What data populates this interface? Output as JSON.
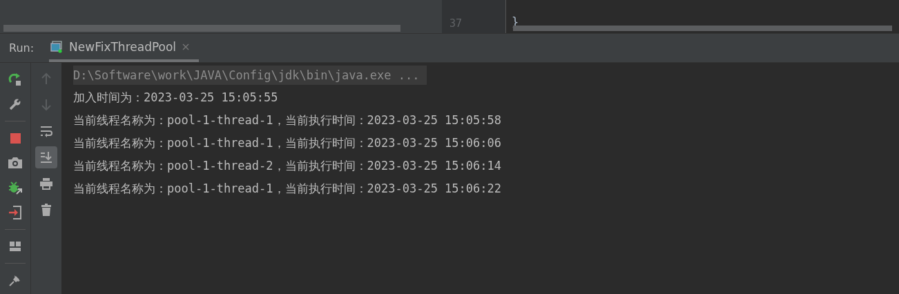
{
  "editor": {
    "line_number": "37",
    "code": "}"
  },
  "run_panel": {
    "label": "Run:",
    "tabs": [
      {
        "label": "NewFixThreadPool",
        "selected": true
      }
    ]
  },
  "left_toolbar": [
    {
      "kind": "rerun"
    },
    {
      "kind": "settings"
    },
    {
      "kind": "separator"
    },
    {
      "kind": "stop"
    },
    {
      "kind": "camera"
    },
    {
      "kind": "debug"
    },
    {
      "kind": "exit"
    },
    {
      "kind": "separator"
    },
    {
      "kind": "layout"
    },
    {
      "kind": "separator"
    },
    {
      "kind": "pin"
    }
  ],
  "right_toolbar": [
    {
      "kind": "up",
      "disabled": true,
      "selected": false
    },
    {
      "kind": "down",
      "disabled": true,
      "selected": false
    },
    {
      "kind": "wrap",
      "disabled": false,
      "selected": false
    },
    {
      "kind": "scroll-end",
      "disabled": false,
      "selected": true
    },
    {
      "kind": "print",
      "disabled": false,
      "selected": false
    },
    {
      "kind": "trash",
      "disabled": false,
      "selected": false
    }
  ],
  "console": [
    {
      "kind": "command",
      "text": "D:\\Software\\work\\JAVA\\Config\\jdk\\bin\\java.exe ..."
    },
    {
      "kind": "output",
      "text": "加入时间为：2023-03-25 15:05:55"
    },
    {
      "kind": "output",
      "text": "当前线程名称为：pool-1-thread-1，当前执行时间：2023-03-25 15:05:58"
    },
    {
      "kind": "output",
      "text": "当前线程名称为：pool-1-thread-1，当前执行时间：2023-03-25 15:06:06"
    },
    {
      "kind": "output",
      "text": "当前线程名称为：pool-1-thread-2，当前执行时间：2023-03-25 15:06:14"
    },
    {
      "kind": "output",
      "text": "当前线程名称为：pool-1-thread-1，当前执行时间：2023-03-25 15:06:22"
    }
  ]
}
